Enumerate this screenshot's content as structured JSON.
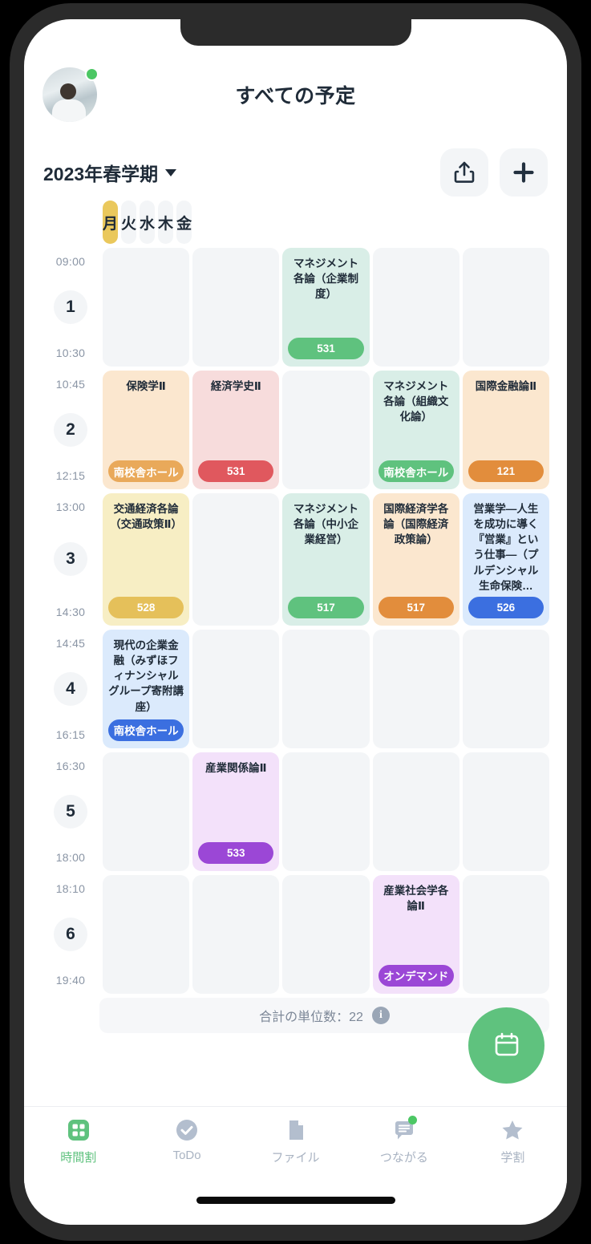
{
  "header": {
    "title": "すべての予定",
    "avatar_name": "user-avatar",
    "online_badge": "online"
  },
  "toolbar": {
    "term": "2023年春学期",
    "share_icon": "share-icon",
    "add_icon": "plus-icon"
  },
  "timetable": {
    "days": [
      {
        "label": "月",
        "today": true
      },
      {
        "label": "火",
        "today": false
      },
      {
        "label": "水",
        "today": false
      },
      {
        "label": "木",
        "today": false
      },
      {
        "label": "金",
        "today": false
      }
    ],
    "periods": [
      {
        "number": "1",
        "start": "09:00",
        "end": "10:30",
        "cells": [
          null,
          null,
          {
            "title": "マネジメント各論（企業制度）",
            "room": "531",
            "bg": "#d9eee7",
            "pill": "#5fc27e"
          },
          null,
          null
        ]
      },
      {
        "number": "2",
        "start": "10:45",
        "end": "12:15",
        "cells": [
          {
            "title": "保険学Ⅱ",
            "room": "南校舎ホール",
            "bg": "#fbe7cf",
            "pill": "#e9a95a"
          },
          {
            "title": "経済学史Ⅱ",
            "room": "531",
            "bg": "#f7dcdc",
            "pill": "#e0585e"
          },
          null,
          {
            "title": "マネジメント各論（組織文化論）",
            "room": "南校舎ホール",
            "bg": "#d9eee7",
            "pill": "#5fc27e"
          },
          {
            "title": "国際金融論Ⅱ",
            "room": "121",
            "bg": "#fbe7cf",
            "pill": "#e28d3c"
          }
        ]
      },
      {
        "number": "3",
        "start": "13:00",
        "end": "14:30",
        "cells": [
          {
            "title": "交通経済各論（交通政策Ⅱ）",
            "room": "528",
            "bg": "#f7eec4",
            "pill": "#e5c05a"
          },
          null,
          {
            "title": "マネジメント各論（中小企業経営）",
            "room": "517",
            "bg": "#d9eee7",
            "pill": "#5fc27e"
          },
          {
            "title": "国際経済学各論（国際経済政策論）",
            "room": "517",
            "bg": "#fbe7cf",
            "pill": "#e28d3c"
          },
          {
            "title": "営業学—人生を成功に導く『営業』という仕事—（プルデンシャル生命保険…",
            "room": "526",
            "bg": "#dbeafc",
            "pill": "#3b6fe0"
          }
        ]
      },
      {
        "number": "4",
        "start": "14:45",
        "end": "16:15",
        "cells": [
          {
            "title": "現代の企業金融（みずほフィナンシャルグループ寄附講座）",
            "room": "南校舎ホール",
            "bg": "#dbeafc",
            "pill": "#3b6fe0"
          },
          null,
          null,
          null,
          null
        ]
      },
      {
        "number": "5",
        "start": "16:30",
        "end": "18:00",
        "cells": [
          null,
          {
            "title": "産業関係論Ⅱ",
            "room": "533",
            "bg": "#f3e1fa",
            "pill": "#9b47d6"
          },
          null,
          null,
          null
        ]
      },
      {
        "number": "6",
        "start": "18:10",
        "end": "19:40",
        "cells": [
          null,
          null,
          null,
          {
            "title": "産業社会学各論Ⅱ",
            "room": "オンデマンド",
            "bg": "#f3e1fa",
            "pill": "#9b47d6"
          },
          null
        ]
      }
    ],
    "credits_label": "合計の単位数：22",
    "credits_info_icon": "info-icon"
  },
  "fab": {
    "icon": "calendar-icon"
  },
  "tabbar": {
    "items": [
      {
        "label": "時間割",
        "icon": "grid-icon",
        "active": true,
        "badge": false
      },
      {
        "label": "ToDo",
        "icon": "check-circle-icon",
        "active": false,
        "badge": false
      },
      {
        "label": "ファイル",
        "icon": "file-icon",
        "active": false,
        "badge": false
      },
      {
        "label": "つながる",
        "icon": "chat-icon",
        "active": false,
        "badge": true
      },
      {
        "label": "学割",
        "icon": "star-icon",
        "active": false,
        "badge": false
      }
    ]
  },
  "colors": {
    "accent_green": "#5fc27e",
    "today_yellow": "#eac85c",
    "text_dark": "#1f2b38",
    "muted": "#8a95a5",
    "frame": "#2b2b2b"
  }
}
